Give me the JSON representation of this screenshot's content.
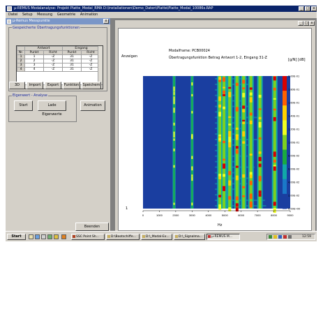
{
  "app": {
    "title": "µ-REMUS Modalanalyse: Projekt Platte_Modal_RMA D:\\Installationen\\Demo_Daten\\Platte\\Platte_Modal_10086s.RAP",
    "menu": [
      "Datei",
      "Setup",
      "Messung",
      "Geometrie",
      "Animation"
    ]
  },
  "panel": {
    "title": "µ-Remus Messpunkte",
    "group_label": "Gespeicherte Übertragungsfunktionen",
    "table": {
      "group_headers": [
        "Antwort",
        "Eingang"
      ],
      "headers": [
        "Nr.",
        "Punkt",
        "Richt",
        "Punkt",
        "Richt"
      ],
      "rows": [
        [
          "1",
          "1",
          "-Z",
          "31",
          "-Z"
        ],
        [
          "2",
          "2",
          "-Z",
          "31",
          "-Z"
        ],
        [
          "3",
          "3",
          "-Z",
          "31",
          "-Z"
        ],
        [
          "4",
          "4",
          "-Z",
          "31",
          "-Z"
        ]
      ]
    },
    "buttons": [
      "3D",
      "Import",
      "Export",
      "Funktion",
      "Speichern"
    ],
    "eigen_group_label": "Eigenwert - Analyse",
    "start": "Start",
    "load": "Lade Eigenwerte",
    "animation": "Animation",
    "close": "Beenden"
  },
  "plot": {
    "title": "Modalframe: PCB00024",
    "subtitle": "Übertragungsfunktion Betrag Antwort 1-2, Eingang 31-Z",
    "y_label": "Anzeigen",
    "colorbar_label": "[g/N] [dB]",
    "x_unit": "Hz",
    "y_bottom": "1"
  },
  "chart_data": {
    "type": "heatmap",
    "title": "Modalframe: PCB00024",
    "subtitle": "Übertragungsfunktion Betrag Antwort 1-2, Eingang 31-Z",
    "xlabel": "Hz",
    "xlim": [
      0,
      9000
    ],
    "x_ticks": [
      "0",
      "1000",
      "2000",
      "3000",
      "4000",
      "5000",
      "6000",
      "7000",
      "8000",
      "9000"
    ],
    "colorbar_ticks": [
      "2,00E-01",
      "1,80E-01",
      "1,60E-01",
      "1,40E-01",
      "1,20E-01",
      "1,00E-01",
      "8,00E-02",
      "6,00E-02",
      "4,00E-02",
      "2,00E-02",
      "0,00E+00"
    ],
    "colorbar_range": [
      0,
      0.2
    ],
    "colors": [
      "#d80000",
      "#ff6000",
      "#ffd000",
      "#f0ff20",
      "#7cd020",
      "#1aaa40",
      "#11a8a8",
      "#1a78c8",
      "#1a3ea0"
    ],
    "peaks_hz": [
      1900,
      3000,
      4700,
      4950,
      5300,
      5750,
      6150,
      6600,
      7150,
      8050
    ]
  },
  "taskbar": {
    "start": "Start",
    "tasks": [
      "SSC Point Sh...",
      "D:\\Bootschiffe...",
      "D:\\_Modal-Ex...",
      "D:\\_Signalma...",
      "µ-REMUS M..."
    ],
    "clock": "12:59"
  }
}
